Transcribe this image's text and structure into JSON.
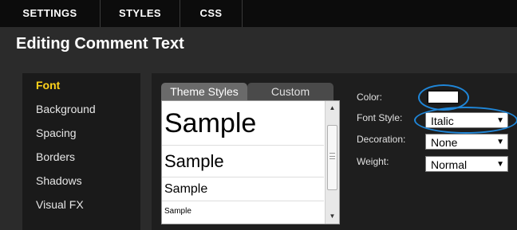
{
  "top_tabs": [
    "SETTINGS",
    "STYLES",
    "CSS"
  ],
  "title": "Editing Comment Text",
  "menu": {
    "items": [
      "Font",
      "Background",
      "Spacing",
      "Borders",
      "Shadows",
      "Visual FX"
    ],
    "active": "Font"
  },
  "subtabs": {
    "theme_styles": "Theme Styles",
    "custom": "Custom",
    "active": "Theme Styles"
  },
  "samples": [
    "Sample",
    "Sample",
    "Sample",
    "Sample"
  ],
  "properties": {
    "color_label": "Color:",
    "color_value": "#ffffff",
    "font_style_label": "Font Style:",
    "font_style_value": "Italic",
    "decoration_label": "Decoration:",
    "decoration_value": "None",
    "weight_label": "Weight:",
    "weight_value": "Normal"
  },
  "icons": {
    "dropdown": "chevron-down-icon",
    "scroll_up": "scroll-up-arrow-icon",
    "scroll_down": "scroll-down-arrow-icon"
  },
  "colors": {
    "accent_active": "#ffd21a",
    "highlight_ring": "#1f86d8",
    "background": "#2b2b2b",
    "topbar": "#0c0c0c"
  }
}
